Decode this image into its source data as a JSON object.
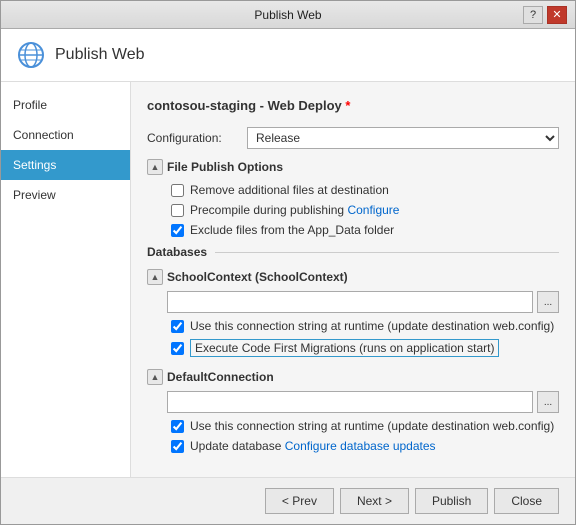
{
  "titleBar": {
    "title": "Publish Web",
    "helpLabel": "?",
    "closeLabel": "✕"
  },
  "header": {
    "title": "Publish Web"
  },
  "sidebar": {
    "items": [
      {
        "id": "profile",
        "label": "Profile"
      },
      {
        "id": "connection",
        "label": "Connection"
      },
      {
        "id": "settings",
        "label": "Settings"
      },
      {
        "id": "preview",
        "label": "Preview"
      }
    ],
    "activeItem": "settings"
  },
  "main": {
    "pageTitle": "contosou-staging - Web Deploy",
    "asterisk": "*",
    "configLabel": "Configuration:",
    "configValue": "Release",
    "filePublishOptions": {
      "sectionLabel": "File Publish Options",
      "options": [
        {
          "id": "remove-additional",
          "label": "Remove additional files at destination",
          "checked": false
        },
        {
          "id": "precompile",
          "label": "Precompile during publishing",
          "checked": false,
          "link": "Configure"
        },
        {
          "id": "exclude-app-data",
          "label": "Exclude files from the App_Data folder",
          "checked": true
        }
      ]
    },
    "databases": {
      "sectionLabel": "Databases",
      "contexts": [
        {
          "id": "school-context",
          "label": "SchoolContext (SchoolContext)",
          "inputValue": "",
          "options": [
            {
              "id": "use-connection-runtime-1",
              "label": "Use this connection string at runtime (update destination web.config)",
              "checked": true
            },
            {
              "id": "code-first-migrations",
              "label": "Execute Code First Migrations (runs on application start)",
              "checked": true,
              "highlighted": true
            }
          ]
        },
        {
          "id": "default-connection",
          "label": "DefaultConnection",
          "inputValue": "",
          "options": [
            {
              "id": "use-connection-runtime-2",
              "label": "Use this connection string at runtime (update destination web.config)",
              "checked": true
            },
            {
              "id": "update-database",
              "label": "Update database",
              "checked": true,
              "link": "Configure database updates"
            }
          ]
        }
      ]
    }
  },
  "footer": {
    "prevLabel": "< Prev",
    "nextLabel": "Next >",
    "publishLabel": "Publish",
    "closeLabel": "Close"
  }
}
